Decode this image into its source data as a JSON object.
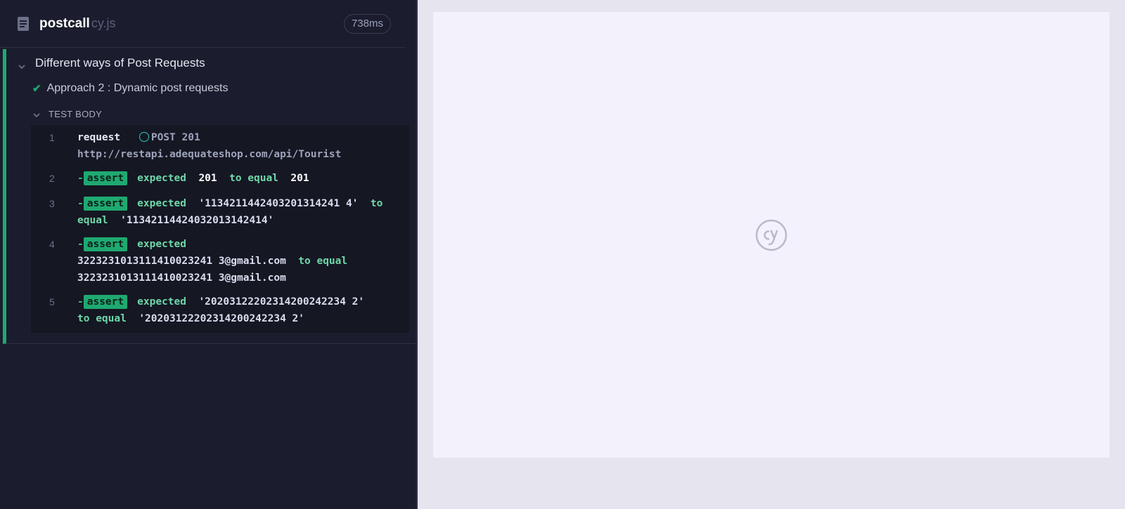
{
  "header": {
    "spec_name": "postcall",
    "spec_ext": "cy.js",
    "duration": "738ms"
  },
  "suite": {
    "title": "Different ways of Post Requests",
    "test": {
      "title": "Approach 2 : Dynamic post requests",
      "status": "passed"
    },
    "test_body_label": "TEST BODY"
  },
  "commands": [
    {
      "num": "1",
      "name": "request",
      "method_status": "POST 201",
      "url": "http://restapi.adequateshop.com/api/Tourist"
    },
    {
      "num": "2",
      "badge": "assert",
      "expected_label": "expected",
      "expected": "201",
      "op": "to equal",
      "actual": "201"
    },
    {
      "num": "3",
      "badge": "assert",
      "expected_label": "expected",
      "expected": "'1134211442403201314241 4'",
      "op": "to",
      "op2": "equal",
      "actual": "'11342114424032013142414'"
    },
    {
      "num": "4",
      "badge": "assert",
      "expected_label": "expected",
      "expected": "3223231013111410023241 3@gmail.com",
      "op": "to equal",
      "actual": "3223231013111410023241 3@gmail.com"
    },
    {
      "num": "5",
      "badge": "assert",
      "expected_label": "expected",
      "expected": "'20203122202314200242234 2'",
      "op": "to equal",
      "actual": "'20203122202314200242234 2'"
    }
  ],
  "colors": {
    "pass_green": "#1fa971",
    "reporter_bg": "#1b1d2e",
    "preview_bg": "#f3f2fc"
  },
  "icons": {
    "file": "file-text-icon",
    "chevron": "chevron-down-icon",
    "check": "check-icon",
    "logo": "cypress-logo-icon"
  }
}
